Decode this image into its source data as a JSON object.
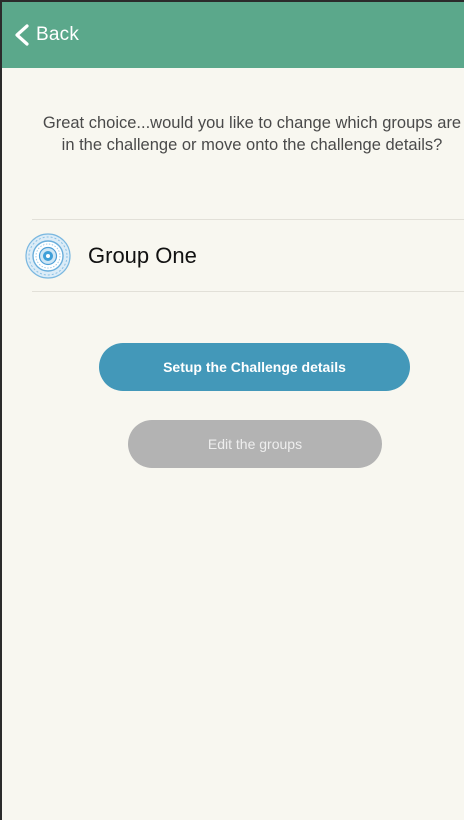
{
  "nav": {
    "back_label": "Back"
  },
  "prompt": {
    "text": "Great choice...would you like to change which groups are in the challenge or move onto the challenge details?"
  },
  "group": {
    "name": "Group One",
    "icon": "group-mandala-icon"
  },
  "buttons": {
    "primary_label": "Setup the Challenge details",
    "secondary_label": "Edit the groups"
  },
  "colors": {
    "nav_bar": "#5ba88b",
    "background": "#f8f7f0",
    "primary_button": "#4398b9",
    "secondary_button": "#b3b3b3",
    "icon_blue": "#3f9fd8"
  }
}
